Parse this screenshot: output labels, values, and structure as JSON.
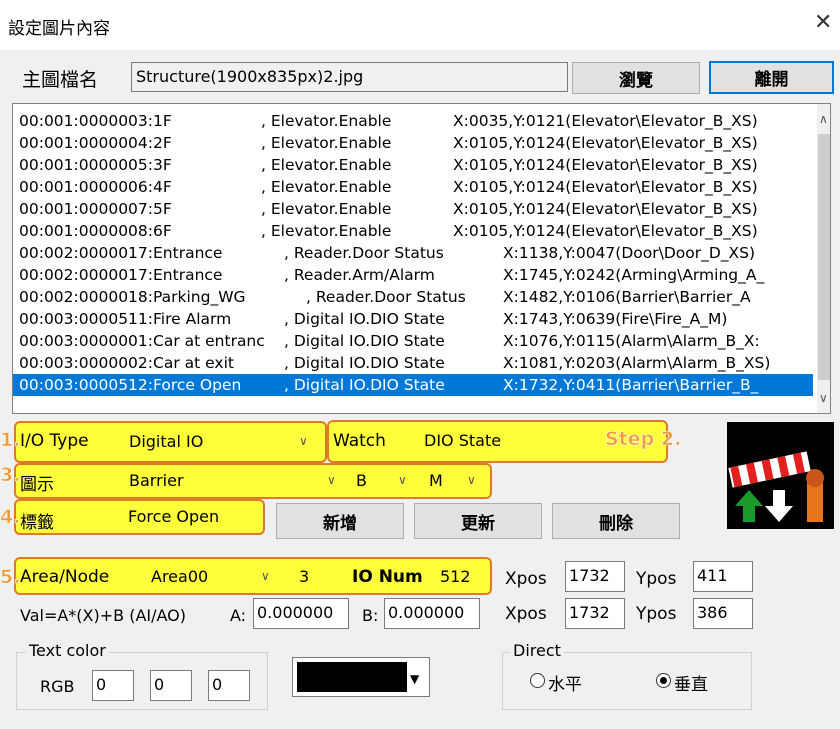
{
  "window": {
    "title": "設定圖片內容",
    "close_glyph": "✕"
  },
  "main_file": {
    "label": "主圖檔名",
    "value": "Structure(1900x835px)2.jpg",
    "browse": "瀏覽",
    "leave": "離開"
  },
  "list": {
    "rows": [
      {
        "id": "00:001:0000003:1F",
        "type": ", Elevator.Enable",
        "pos": "X:0035,Y:0121(Elevator\\Elevator_B_XS)",
        "selected": false
      },
      {
        "id": "00:001:0000004:2F",
        "type": ", Elevator.Enable",
        "pos": "X:0105,Y:0124(Elevator\\Elevator_B_XS)",
        "selected": false
      },
      {
        "id": "00:001:0000005:3F",
        "type": ", Elevator.Enable",
        "pos": "X:0105,Y:0124(Elevator\\Elevator_B_XS)",
        "selected": false
      },
      {
        "id": "00:001:0000006:4F",
        "type": ", Elevator.Enable",
        "pos": "X:0105,Y:0124(Elevator\\Elevator_B_XS)",
        "selected": false
      },
      {
        "id": "00:001:0000007:5F",
        "type": ", Elevator.Enable",
        "pos": "X:0105,Y:0124(Elevator\\Elevator_B_XS)",
        "selected": false
      },
      {
        "id": "00:001:0000008:6F",
        "type": ", Elevator.Enable",
        "pos": "X:0105,Y:0124(Elevator\\Elevator_B_XS)",
        "selected": false
      },
      {
        "id": "00:002:0000017:Entrance",
        "type": ", Reader.Door Status",
        "pos": "X:1138,Y:0047(Door\\Door_D_XS)",
        "selected": false
      },
      {
        "id": "00:002:0000017:Entrance",
        "type": ", Reader.Arm/Alarm",
        "pos": "X:1745,Y:0242(Arming\\Arming_A_",
        "selected": false
      },
      {
        "id": "00:002:0000018:Parking_WG",
        "type": ", Reader.Door Status",
        "pos": "X:1482,Y:0106(Barrier\\Barrier_A",
        "selected": false
      },
      {
        "id": "00:003:0000511:Fire Alarm",
        "type": ", Digital IO.DIO State",
        "pos": "X:1743,Y:0639(Fire\\Fire_A_M)",
        "selected": false
      },
      {
        "id": "00:003:0000001:Car at entranc",
        "type": ", Digital IO.DIO State",
        "pos": "X:1076,Y:0115(Alarm\\Alarm_B_X:",
        "selected": false
      },
      {
        "id": "00:003:0000002:Car at exit",
        "type": ", Digital IO.DIO State",
        "pos": "X:1081,Y:0203(Alarm\\Alarm_B_XS)",
        "selected": false
      },
      {
        "id": "00:003:0000512:Force Open",
        "type": ", Digital IO.DIO State",
        "pos": "X:1732,Y:0411(Barrier\\Barrier_B_",
        "selected": true
      }
    ]
  },
  "steps": {
    "s1": "1.",
    "s2": "Step 2.",
    "s3": "3.",
    "s4": "4.",
    "s5": "5."
  },
  "io": {
    "type_label": "I/O Type",
    "type_value": "Digital IO",
    "watch_label": "Watch",
    "watch_value": "DIO State"
  },
  "icon": {
    "label": "圖示",
    "value": "Barrier",
    "size": "B",
    "variant": "M",
    "preview_icon": "barrier-gate-icon"
  },
  "tag": {
    "label": "標籤",
    "value": "Force Open",
    "add": "新增",
    "update": "更新",
    "delete": "刪除"
  },
  "area": {
    "label": "Area/Node",
    "value": "Area00",
    "node": "3",
    "ionum_label": "IO Num",
    "ionum": "512"
  },
  "pos1": {
    "xlabel": "Xpos",
    "x": "1732",
    "ylabel": "Ypos",
    "y": "411"
  },
  "pos2": {
    "xlabel": "Xpos",
    "x": "1732",
    "ylabel": "Ypos",
    "y": "386"
  },
  "val": {
    "formula": "Val=A*(X)+B (AI/AO)",
    "a_label": "A:",
    "a": "0.000000",
    "b_label": "B:",
    "b": "0.000000"
  },
  "text_color": {
    "legend": "Text color",
    "rgb_label": "RGB",
    "r": "0",
    "g": "0",
    "b": "0",
    "swatch": "#000000"
  },
  "direct": {
    "legend": "Direct",
    "horizontal": "水平",
    "vertical": "垂直",
    "selected": "vertical"
  },
  "colors": {
    "highlight": "#ffff3c",
    "outline": "#e07a2a",
    "selection": "#0078d7"
  }
}
